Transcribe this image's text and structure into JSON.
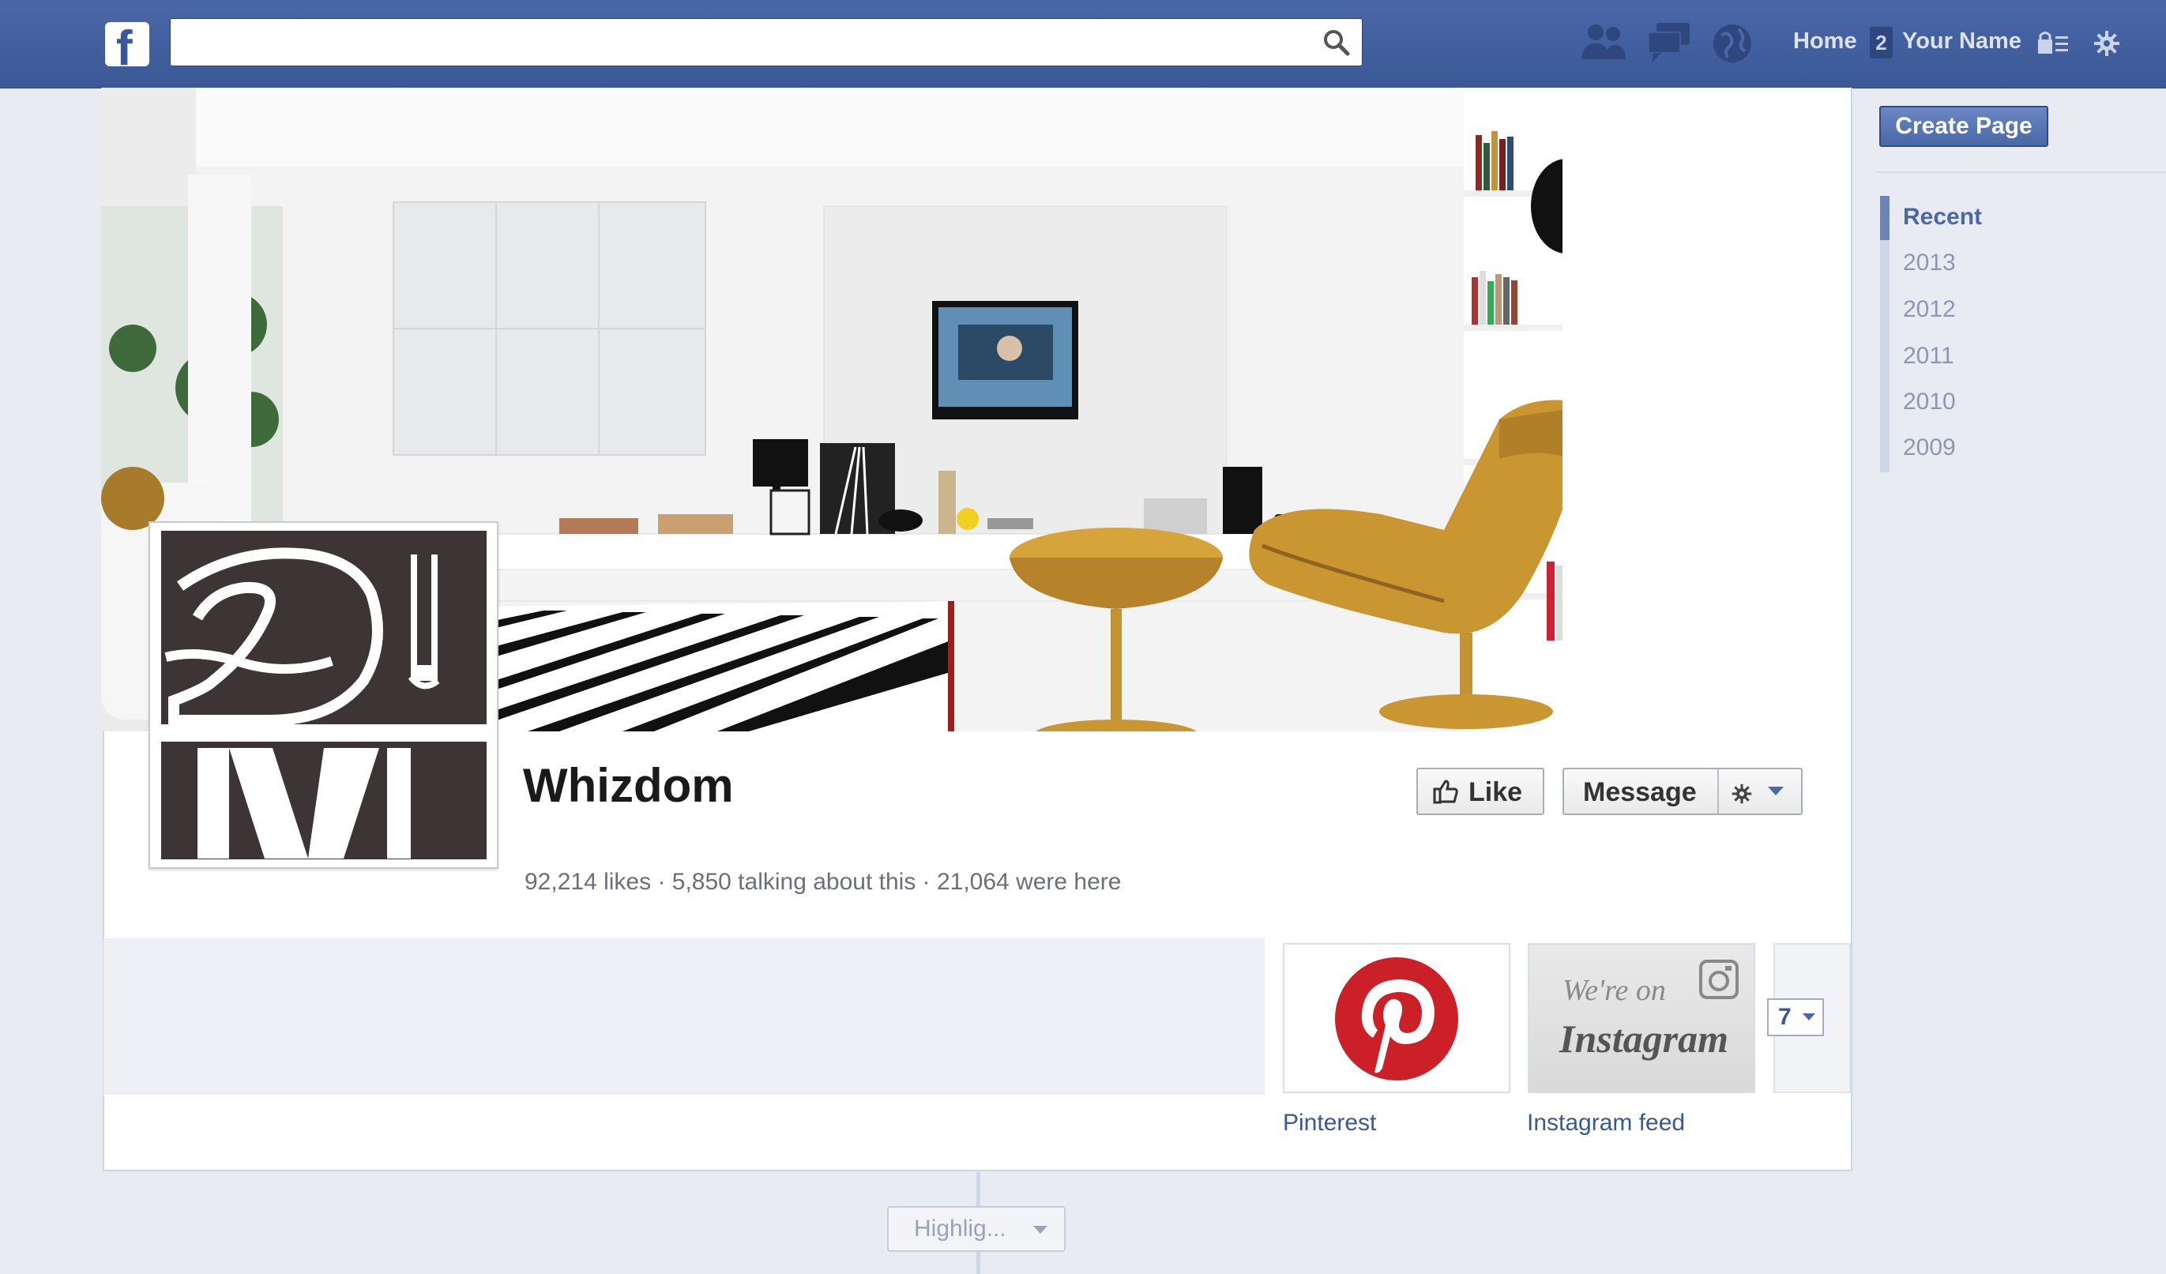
{
  "topbar": {
    "logo_letter": "f",
    "search": {
      "value": "",
      "placeholder": ""
    },
    "nav": {
      "home": "Home",
      "notification_count": "2",
      "your_name": "Your Name"
    },
    "icons": [
      "friend-requests-icon",
      "messages-icon",
      "notifications-globe-icon",
      "privacy-lock-icon",
      "settings-gear-icon"
    ]
  },
  "page": {
    "title": "Whizdom",
    "cover_brand_top": "whiz",
    "cover_brand_mid": "DO",
    "cover_brand_bottom": "M",
    "buttons": {
      "like": "Like",
      "message": "Message"
    },
    "stats": "92,214 likes · 5,850 talking about this · 21,064 were here"
  },
  "apps": {
    "tiles": [
      {
        "label": "Pinterest"
      },
      {
        "label": "Instagram feed",
        "art_line1": "We're on",
        "art_line2": "Instagram"
      }
    ],
    "more_count": "7"
  },
  "sidebar": {
    "create_page": "Create Page",
    "years": [
      "Recent",
      "2013",
      "2012",
      "2011",
      "2010",
      "2009"
    ]
  },
  "timeline": {
    "highlights": "Highlig..."
  },
  "colors": {
    "brand_blue": "#3b5896",
    "chair_mustard": "#c99632",
    "pinterest_red": "#cb2027",
    "logo_dark": "#3d3436"
  }
}
